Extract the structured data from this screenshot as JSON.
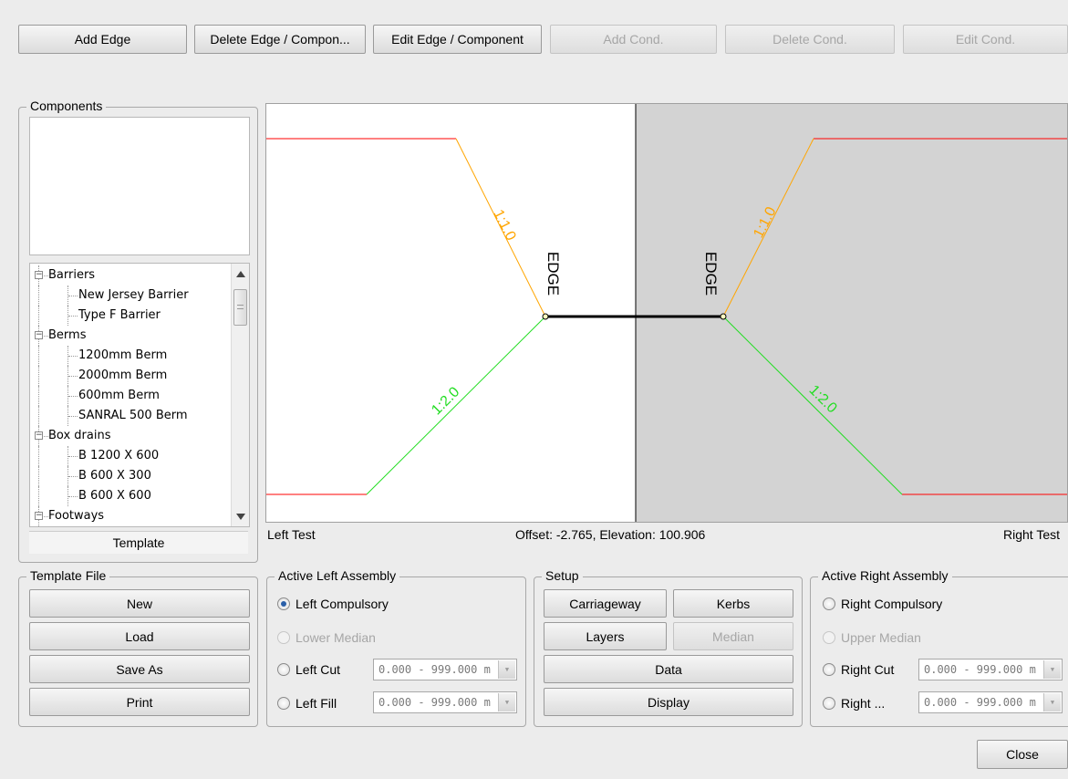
{
  "toolbar": {
    "add_edge": "Add Edge",
    "delete_edge": "Delete Edge / Compon...",
    "edit_edge": "Edit Edge / Component",
    "add_cond": "Add Cond.",
    "delete_cond": "Delete Cond.",
    "edit_cond": "Edit Cond."
  },
  "components": {
    "title": "Components",
    "tree": [
      {
        "label": "Barriers",
        "type": "group"
      },
      {
        "label": "New Jersey Barrier",
        "type": "item"
      },
      {
        "label": "Type F Barrier",
        "type": "item"
      },
      {
        "label": "Berms",
        "type": "group"
      },
      {
        "label": "1200mm Berm",
        "type": "item"
      },
      {
        "label": "2000mm Berm",
        "type": "item"
      },
      {
        "label": "600mm Berm",
        "type": "item"
      },
      {
        "label": "SANRAL 500 Berm",
        "type": "item"
      },
      {
        "label": "Box drains",
        "type": "group"
      },
      {
        "label": "B 1200 X 600",
        "type": "item"
      },
      {
        "label": "B 600 X 300",
        "type": "item"
      },
      {
        "label": "B 600 X 600",
        "type": "item"
      },
      {
        "label": "Footways",
        "type": "group"
      }
    ],
    "template_tab": "Template"
  },
  "canvas": {
    "left_slope_top": "1:1.0",
    "left_slope_bottom": "1:2.0",
    "right_slope_top": "1:1.0",
    "right_slope_bottom": "1:2.0",
    "edge_left": "EDGE",
    "edge_right": "EDGE",
    "colors": {
      "red": "#ff0000",
      "orange": "#ffa500",
      "green": "#22dd22",
      "right_bg": "#d3d3d3"
    }
  },
  "status": {
    "left": "Left Test",
    "center": "Offset: -2.765, Elevation: 100.906",
    "right": "Right Test"
  },
  "template_file": {
    "title": "Template File",
    "new": "New",
    "load": "Load",
    "save_as": "Save As",
    "print": "Print"
  },
  "left_assembly": {
    "title": "Active Left Assembly",
    "compulsory": "Left Compulsory",
    "lower_median": "Lower Median",
    "cut": "Left Cut",
    "fill": "Left Fill",
    "cut_range": "0.000 - 999.000 m",
    "fill_range": "0.000 - 999.000 m"
  },
  "setup": {
    "title": "Setup",
    "carriageway": "Carriageway",
    "kerbs": "Kerbs",
    "layers": "Layers",
    "median": "Median",
    "data": "Data",
    "display": "Display"
  },
  "right_assembly": {
    "title": "Active Right Assembly",
    "compulsory": "Right Compulsory",
    "upper_median": "Upper Median",
    "cut": "Right Cut",
    "fill": "Right ...",
    "cut_range": "0.000 - 999.000 m",
    "fill_range": "0.000 - 999.000 m"
  },
  "close": "Close"
}
